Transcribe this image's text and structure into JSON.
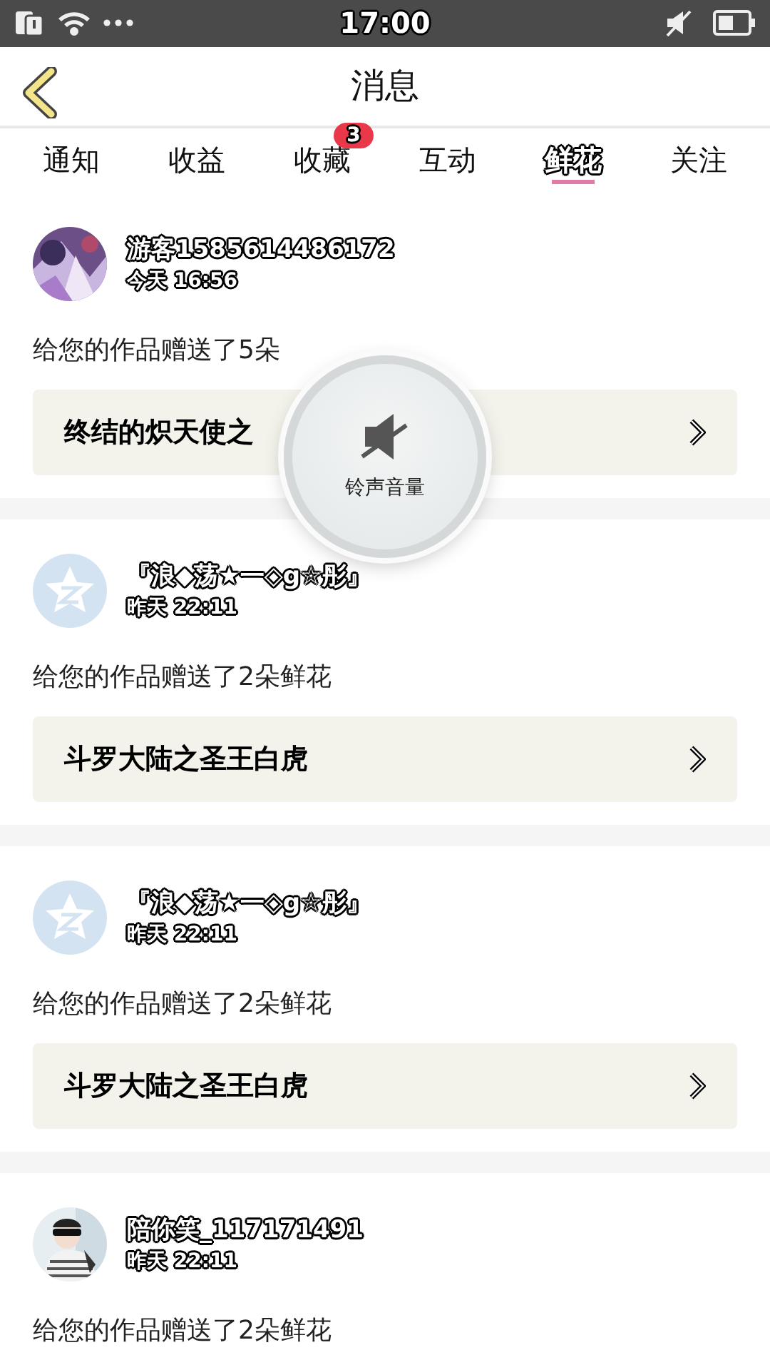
{
  "status_bar": {
    "time": "17:00"
  },
  "header": {
    "title": "消息"
  },
  "tabs": [
    {
      "label": "通知",
      "selected": false
    },
    {
      "label": "收益",
      "selected": false
    },
    {
      "label": "收藏",
      "selected": false,
      "badge": "3"
    },
    {
      "label": "互动",
      "selected": false
    },
    {
      "label": "鲜花",
      "selected": true
    },
    {
      "label": "关注",
      "selected": false
    }
  ],
  "messages": [
    {
      "kind": "picture",
      "name": "游客1585614486172",
      "time": "今天 16:56",
      "text": "给您的作品赠送了5朵",
      "work": "终结的炽天使之"
    },
    {
      "kind": "default",
      "name": "『浪◆荡★一◇g☆彤』",
      "time": "昨天 22:11",
      "text": "给您的作品赠送了2朵鲜花",
      "work": "斗罗大陆之圣王白虎"
    },
    {
      "kind": "default",
      "name": "『浪◆荡★一◇g☆彤』",
      "time": "昨天 22:11",
      "text": "给您的作品赠送了2朵鲜花",
      "work": "斗罗大陆之圣王白虎"
    },
    {
      "kind": "picture",
      "name": "陪你笑_117171491",
      "time": "昨天 22:11",
      "text": "给您的作品赠送了2朵鲜花"
    }
  ],
  "volume_toast": {
    "label": "铃声音量"
  }
}
